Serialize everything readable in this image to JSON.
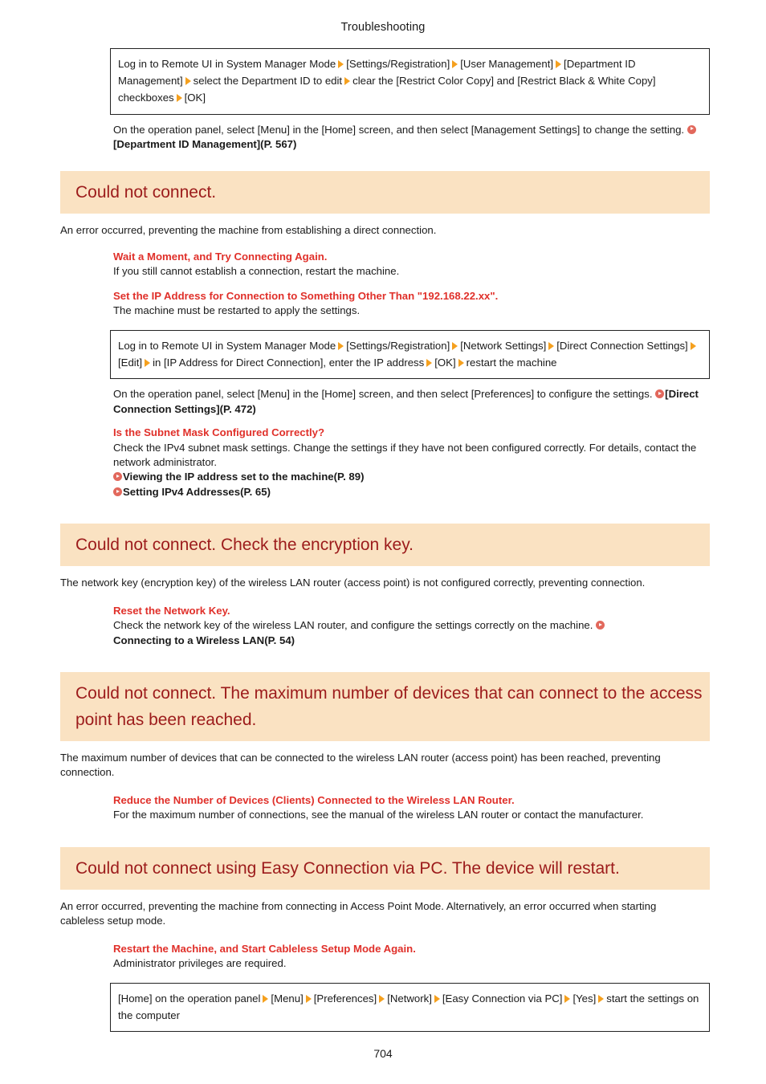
{
  "document": {
    "running_header": "Troubleshooting",
    "page_number": "704"
  },
  "colors": {
    "heading_background": "#FAE2C2",
    "heading_text": "#9C1B1B",
    "remedy_title": "#E0302A",
    "arrow": "#F5A01E",
    "link_icon": "#E2685C",
    "box_border": "#222222",
    "body_text": "#1A1A1A"
  },
  "top_procedure_box": {
    "segments": [
      "Log in to Remote UI in System Manager Mode",
      "[Settings/Registration]",
      "[User Management]",
      "[Department ID Management]",
      "select the Department ID to edit",
      "clear the [Restrict Color Copy] and [Restrict Black & White Copy] checkboxes",
      "[OK]"
    ]
  },
  "top_note": {
    "text": "On the operation panel, select [Menu] in the [Home] screen, and then select [Management Settings] to change the setting.",
    "xref": "[Department ID Management](P. 567)"
  },
  "sections": [
    {
      "heading": "Could not connect.",
      "intro": "An error occurred, preventing the machine from establishing a direct connection.",
      "remedies": [
        {
          "title": "Wait a Moment, and Try Connecting Again.",
          "body": "If you still cannot establish a connection, restart the machine."
        },
        {
          "title": "Set the IP Address for Connection to Something Other Than \"192.168.22.xx\".",
          "body": "The machine must be restarted to apply the settings."
        }
      ],
      "procedure_box": {
        "segments": [
          "Log in to Remote UI in System Manager Mode",
          "[Settings/Registration]",
          "[Network Settings]",
          "[Direct Connection Settings]",
          "[Edit]",
          "in [IP Address for Direct Connection], enter the IP address",
          "[OK]",
          "restart the machine"
        ]
      },
      "note": {
        "text": "On the operation panel, select [Menu] in the [Home] screen, and then select [Preferences] to configure the settings.",
        "xref": "[Direct Connection Settings](P. 472)"
      },
      "subnet_remedy": {
        "title": "Is the Subnet Mask Configured Correctly?",
        "body": "Check the IPv4 subnet mask settings. Change the settings if they have not been configured correctly. For details, contact the network administrator.",
        "links": [
          "Viewing the IP address set to the machine(P. 89)",
          "Setting IPv4 Addresses(P. 65)"
        ]
      }
    },
    {
      "heading": "Could not connect. Check the encryption key.",
      "intro": "The network key (encryption key) of the wireless LAN router (access point) is not configured correctly, preventing connection.",
      "remedies": [
        {
          "title": "Reset the Network Key.",
          "body": "Check the network key of the wireless LAN router, and configure the settings correctly on the machine.",
          "xref": "Connecting to a Wireless LAN(P. 54)"
        }
      ]
    },
    {
      "heading": "Could not connect. The maximum number of devices that can connect to the access point has been reached.",
      "intro": "The maximum number of devices that can be connected to the wireless LAN router (access point) has been reached, preventing connection.",
      "remedies": [
        {
          "title": "Reduce the Number of Devices (Clients) Connected to the Wireless LAN Router.",
          "body": "For the maximum number of connections, see the manual of the wireless LAN router or contact the manufacturer."
        }
      ]
    },
    {
      "heading": "Could not connect using Easy Connection via PC. The device will restart.",
      "intro": "An error occurred, preventing the machine from connecting in Access Point Mode. Alternatively, an error occurred when starting cableless setup mode.",
      "remedies": [
        {
          "title": "Restart the Machine, and Start Cableless Setup Mode Again.",
          "body": "Administrator privileges are required."
        }
      ],
      "procedure_box": {
        "segments": [
          "[Home] on the operation panel",
          "[Menu]",
          "[Preferences]",
          "[Network]",
          "[Easy Connection via PC]",
          "[Yes]",
          "start the settings on the computer"
        ]
      }
    }
  ],
  "icons": {
    "arrow": "triangle-right-icon",
    "link": "link-bullet-icon"
  }
}
